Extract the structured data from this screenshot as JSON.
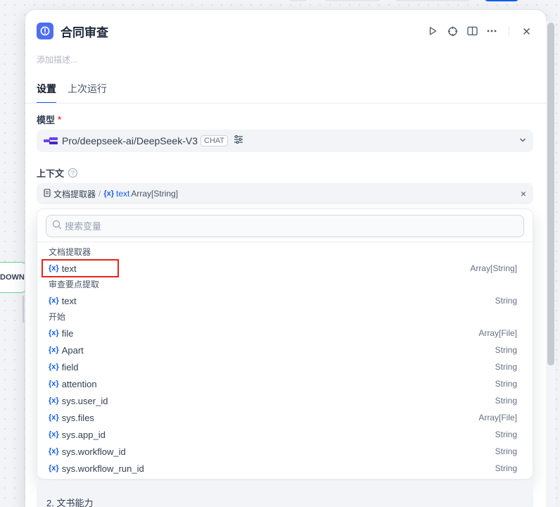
{
  "node": {
    "title": "合同审查",
    "description_placeholder": "添加描述...",
    "icon": "info-icon"
  },
  "header_actions": [
    "play-icon",
    "crosshair-icon",
    "split-view-icon",
    "more-icon",
    "close-icon"
  ],
  "tabs": [
    {
      "label": "设置",
      "active": true
    },
    {
      "label": "上次运行",
      "active": false
    }
  ],
  "model": {
    "label": "模型",
    "required_mark": "*",
    "name": "Pro/deepseek-ai/DeepSeek-V3",
    "mode": "CHAT"
  },
  "context": {
    "label": "上下文",
    "help": "?",
    "node_name": "文档提取器",
    "separator": "/",
    "var_symbol": "{x}",
    "var_name": "text",
    "var_type": "Array[String]",
    "clear": "×"
  },
  "variable_picker": {
    "search_placeholder": "搜索变量",
    "var_symbol": "{x}",
    "groups": [
      {
        "title": "文档提取器",
        "items": [
          {
            "name": "text",
            "type": "Array[String]",
            "highlighted": true
          }
        ]
      },
      {
        "title": "审查要点提取",
        "items": [
          {
            "name": "text",
            "type": "String"
          }
        ]
      },
      {
        "title": "开始",
        "items": [
          {
            "name": "file",
            "type": "Array[File]"
          },
          {
            "name": "Apart",
            "type": "String"
          },
          {
            "name": "field",
            "type": "String"
          },
          {
            "name": "attention",
            "type": "String"
          },
          {
            "name": "sys.user_id",
            "type": "String"
          },
          {
            "name": "sys.files",
            "type": "Array[File]"
          },
          {
            "name": "sys.app_id",
            "type": "String"
          },
          {
            "name": "sys.workflow_id",
            "type": "String"
          },
          {
            "name": "sys.workflow_run_id",
            "type": "String"
          }
        ]
      }
    ]
  },
  "background_text": "2. 文书能力",
  "canvas_node_label": "DOWN",
  "colors": {
    "accent": "#155eef",
    "highlight_box": "#e5251b",
    "node_icon_bg": "#4e6ef2"
  }
}
